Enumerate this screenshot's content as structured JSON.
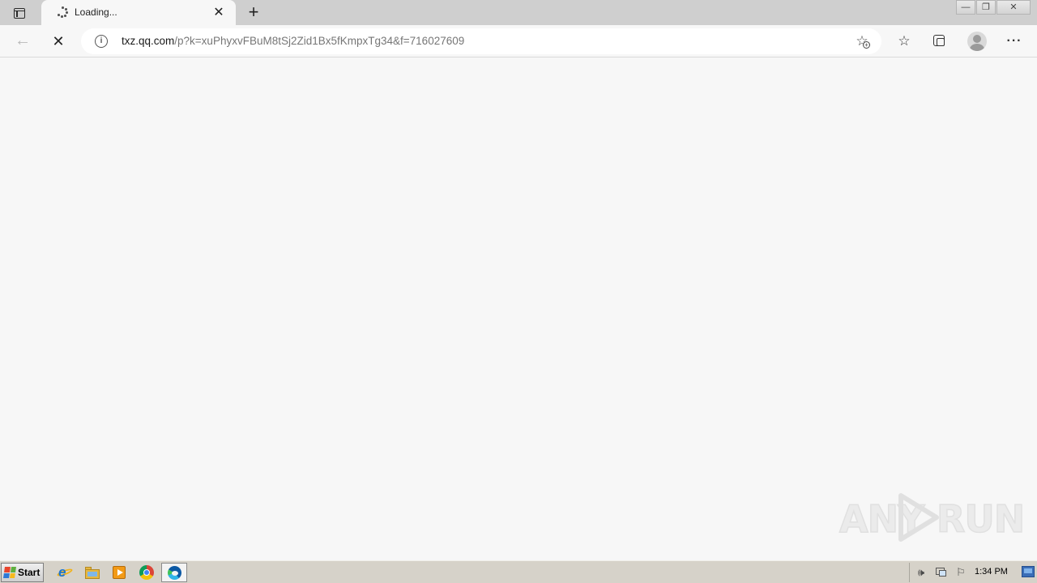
{
  "browser": {
    "tab": {
      "title": "Loading...",
      "close_glyph": "✕"
    },
    "new_tab_glyph": "+",
    "window_controls": {
      "minimize_glyph": "—",
      "restore_glyph": "❐",
      "close_glyph": "✕"
    },
    "toolbar": {
      "back_glyph": "←",
      "stop_glyph": "✕",
      "more_glyph": "···",
      "favorites_glyph": "☆"
    },
    "address": {
      "host": "txz.qq.com",
      "path": "/p?k=xuPhyxvFBuM8tSj2Zid1Bx5fKmpxTg34&f=716027609",
      "info_glyph": "i",
      "add_favorite_glyph": "☆"
    }
  },
  "watermark": {
    "left": "ANY",
    "right": "RUN"
  },
  "taskbar": {
    "start_label": "Start",
    "clock": "1:34 PM",
    "sound_glyph": "🕪",
    "flag_glyph": "⚐",
    "quick_launch": [
      "internet-explorer",
      "file-explorer",
      "media-player",
      "google-chrome",
      "microsoft-edge"
    ]
  }
}
